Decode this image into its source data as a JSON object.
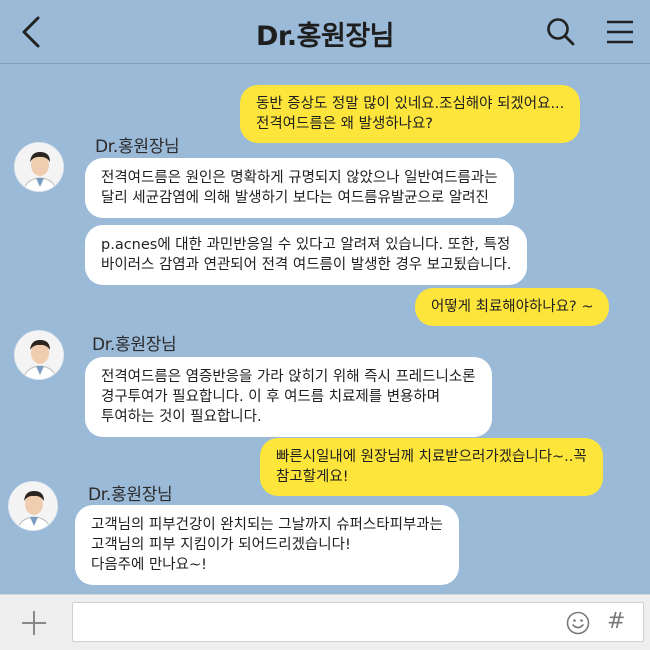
{
  "header": {
    "title": "Dr.홍원장님",
    "back_icon": "chevron-left-icon",
    "search_icon": "search-icon",
    "menu_icon": "hamburger-menu-icon"
  },
  "messages": [
    {
      "type": "outgoing",
      "lines": [
        "동반 증상도 정말 많이 있네요.조심해야 되겠어요...",
        "전격여드름은 왜 발생하나요?"
      ]
    },
    {
      "type": "incoming",
      "sender": "Dr.홍원장님",
      "lines": [
        "전격여드름은 원인은 명확하게 규명되지 않았으나 일반여드름과는",
        "달리 세균감염에 의해 발생하기 보다는 여드름유발균으로 알려진"
      ]
    },
    {
      "type": "incoming",
      "lines": [
        "p.acnes에 대한 과민반응일 수 있다고 알려져 있습니다. 또한, 특정",
        "바이러스 감염과 연관되어 전격 여드름이 발생한 경우 보고됬습니다."
      ]
    },
    {
      "type": "outgoing",
      "lines": [
        "어떻게 최료해야하나요? ~"
      ]
    },
    {
      "type": "incoming",
      "sender": "Dr.홍원장님",
      "lines": [
        "전격여드름은 염증반응을 가라 앉히기 위해 즉시 프레드니소론",
        "경구투여가 필요합니다. 이 후 여드름 치료제를 변용하며",
        "투여하는 것이 필요합니다."
      ]
    },
    {
      "type": "outgoing",
      "lines": [
        "빠른시일내에 원장님께 치료받으러가겠습니다~..꼭",
        "참고할게요!"
      ]
    },
    {
      "type": "incoming",
      "sender": "Dr.홍원장님",
      "lines": [
        "고객님의 피부건강이 완치되는 그날까지 슈퍼스타피부과는",
        "고객님의 피부 지킴이가 되어드리겠습니다!",
        "다음주에 만나요~!"
      ]
    }
  ],
  "input_bar": {
    "plus_icon": "plus-icon",
    "message_value": "",
    "emoji_icon": "emoji-icon",
    "hash_label": "#"
  },
  "colors": {
    "background": "#9bbad8",
    "outgoing_bubble": "#fde53c",
    "incoming_bubble": "#ffffff"
  }
}
